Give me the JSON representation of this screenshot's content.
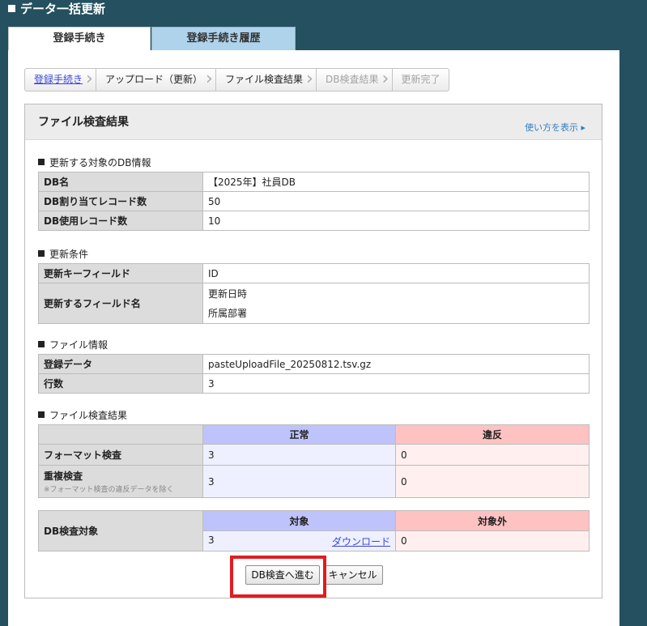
{
  "page": {
    "title": "データ一括更新"
  },
  "tabs": [
    {
      "label": "登録手続き"
    },
    {
      "label": "登録手続き履歴"
    }
  ],
  "steps": [
    {
      "label": "登録手続き"
    },
    {
      "label": "アップロード（更新）"
    },
    {
      "label": "ファイル検査結果"
    },
    {
      "label": "DB検査結果"
    },
    {
      "label": "更新完了"
    }
  ],
  "section": {
    "title": "ファイル検査結果",
    "help_link": "使い方を表示 ▸"
  },
  "db_info": {
    "heading": "更新する対象のDB情報",
    "rows": [
      {
        "label": "DB名",
        "value": "【2025年】社員DB"
      },
      {
        "label": "DB割り当てレコード数",
        "value": "50"
      },
      {
        "label": "DB使用レコード数",
        "value": "10"
      }
    ]
  },
  "update_conditions": {
    "heading": "更新条件",
    "key_field_label": "更新キーフィールド",
    "key_field_value": "ID",
    "fields_label": "更新するフィールド名",
    "fields": [
      "更新日時",
      "所属部署"
    ]
  },
  "file_info": {
    "heading": "ファイル情報",
    "rows": [
      {
        "label": "登録データ",
        "value": "pasteUploadFile_20250812.tsv.gz"
      },
      {
        "label": "行数",
        "value": "3"
      }
    ]
  },
  "inspection": {
    "heading": "ファイル検査結果",
    "col_ok": "正常",
    "col_ng": "違反",
    "format_label": "フォーマット検査",
    "format_ok": "3",
    "format_ng": "0",
    "dup_label": "重複検査",
    "dup_note": "※フォーマット検査の違反データを除く",
    "dup_ok": "3",
    "dup_ng": "0"
  },
  "db_target": {
    "label": "DB検査対象",
    "col_target": "対象",
    "col_non_target": "対象外",
    "target_value": "3",
    "download_label": "ダウンロード",
    "non_target_value": "0"
  },
  "actions": {
    "proceed_label": "DB検査へ進む",
    "cancel_label": "キャンセル"
  },
  "colors": {
    "background": "#25505f",
    "highlight": "#e01c24",
    "ok_header": "#bfc3fb",
    "ng_header": "#ffc2c2"
  }
}
